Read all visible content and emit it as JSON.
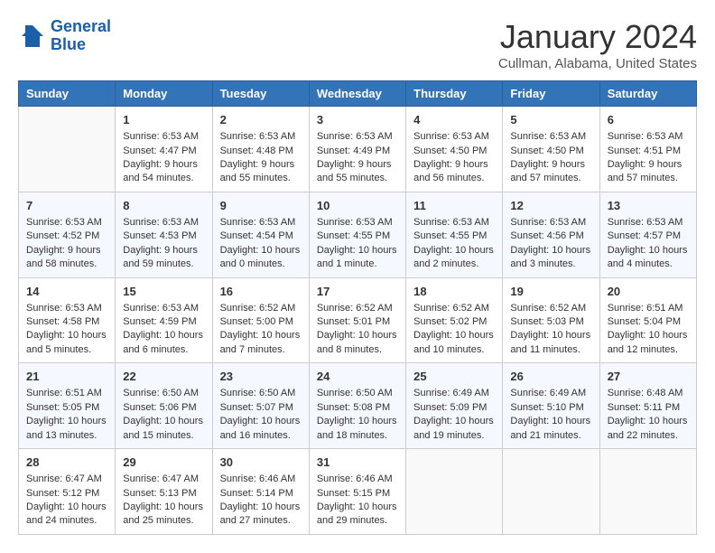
{
  "header": {
    "logo_line1": "General",
    "logo_line2": "Blue",
    "month": "January 2024",
    "location": "Cullman, Alabama, United States"
  },
  "days_of_week": [
    "Sunday",
    "Monday",
    "Tuesday",
    "Wednesday",
    "Thursday",
    "Friday",
    "Saturday"
  ],
  "weeks": [
    [
      {
        "day": "",
        "content": ""
      },
      {
        "day": "1",
        "content": "Sunrise: 6:53 AM\nSunset: 4:47 PM\nDaylight: 9 hours\nand 54 minutes."
      },
      {
        "day": "2",
        "content": "Sunrise: 6:53 AM\nSunset: 4:48 PM\nDaylight: 9 hours\nand 55 minutes."
      },
      {
        "day": "3",
        "content": "Sunrise: 6:53 AM\nSunset: 4:49 PM\nDaylight: 9 hours\nand 55 minutes."
      },
      {
        "day": "4",
        "content": "Sunrise: 6:53 AM\nSunset: 4:50 PM\nDaylight: 9 hours\nand 56 minutes."
      },
      {
        "day": "5",
        "content": "Sunrise: 6:53 AM\nSunset: 4:50 PM\nDaylight: 9 hours\nand 57 minutes."
      },
      {
        "day": "6",
        "content": "Sunrise: 6:53 AM\nSunset: 4:51 PM\nDaylight: 9 hours\nand 57 minutes."
      }
    ],
    [
      {
        "day": "7",
        "content": "Sunrise: 6:53 AM\nSunset: 4:52 PM\nDaylight: 9 hours\nand 58 minutes."
      },
      {
        "day": "8",
        "content": "Sunrise: 6:53 AM\nSunset: 4:53 PM\nDaylight: 9 hours\nand 59 minutes."
      },
      {
        "day": "9",
        "content": "Sunrise: 6:53 AM\nSunset: 4:54 PM\nDaylight: 10 hours\nand 0 minutes."
      },
      {
        "day": "10",
        "content": "Sunrise: 6:53 AM\nSunset: 4:55 PM\nDaylight: 10 hours\nand 1 minute."
      },
      {
        "day": "11",
        "content": "Sunrise: 6:53 AM\nSunset: 4:55 PM\nDaylight: 10 hours\nand 2 minutes."
      },
      {
        "day": "12",
        "content": "Sunrise: 6:53 AM\nSunset: 4:56 PM\nDaylight: 10 hours\nand 3 minutes."
      },
      {
        "day": "13",
        "content": "Sunrise: 6:53 AM\nSunset: 4:57 PM\nDaylight: 10 hours\nand 4 minutes."
      }
    ],
    [
      {
        "day": "14",
        "content": "Sunrise: 6:53 AM\nSunset: 4:58 PM\nDaylight: 10 hours\nand 5 minutes."
      },
      {
        "day": "15",
        "content": "Sunrise: 6:53 AM\nSunset: 4:59 PM\nDaylight: 10 hours\nand 6 minutes."
      },
      {
        "day": "16",
        "content": "Sunrise: 6:52 AM\nSunset: 5:00 PM\nDaylight: 10 hours\nand 7 minutes."
      },
      {
        "day": "17",
        "content": "Sunrise: 6:52 AM\nSunset: 5:01 PM\nDaylight: 10 hours\nand 8 minutes."
      },
      {
        "day": "18",
        "content": "Sunrise: 6:52 AM\nSunset: 5:02 PM\nDaylight: 10 hours\nand 10 minutes."
      },
      {
        "day": "19",
        "content": "Sunrise: 6:52 AM\nSunset: 5:03 PM\nDaylight: 10 hours\nand 11 minutes."
      },
      {
        "day": "20",
        "content": "Sunrise: 6:51 AM\nSunset: 5:04 PM\nDaylight: 10 hours\nand 12 minutes."
      }
    ],
    [
      {
        "day": "21",
        "content": "Sunrise: 6:51 AM\nSunset: 5:05 PM\nDaylight: 10 hours\nand 13 minutes."
      },
      {
        "day": "22",
        "content": "Sunrise: 6:50 AM\nSunset: 5:06 PM\nDaylight: 10 hours\nand 15 minutes."
      },
      {
        "day": "23",
        "content": "Sunrise: 6:50 AM\nSunset: 5:07 PM\nDaylight: 10 hours\nand 16 minutes."
      },
      {
        "day": "24",
        "content": "Sunrise: 6:50 AM\nSunset: 5:08 PM\nDaylight: 10 hours\nand 18 minutes."
      },
      {
        "day": "25",
        "content": "Sunrise: 6:49 AM\nSunset: 5:09 PM\nDaylight: 10 hours\nand 19 minutes."
      },
      {
        "day": "26",
        "content": "Sunrise: 6:49 AM\nSunset: 5:10 PM\nDaylight: 10 hours\nand 21 minutes."
      },
      {
        "day": "27",
        "content": "Sunrise: 6:48 AM\nSunset: 5:11 PM\nDaylight: 10 hours\nand 22 minutes."
      }
    ],
    [
      {
        "day": "28",
        "content": "Sunrise: 6:47 AM\nSunset: 5:12 PM\nDaylight: 10 hours\nand 24 minutes."
      },
      {
        "day": "29",
        "content": "Sunrise: 6:47 AM\nSunset: 5:13 PM\nDaylight: 10 hours\nand 25 minutes."
      },
      {
        "day": "30",
        "content": "Sunrise: 6:46 AM\nSunset: 5:14 PM\nDaylight: 10 hours\nand 27 minutes."
      },
      {
        "day": "31",
        "content": "Sunrise: 6:46 AM\nSunset: 5:15 PM\nDaylight: 10 hours\nand 29 minutes."
      },
      {
        "day": "",
        "content": ""
      },
      {
        "day": "",
        "content": ""
      },
      {
        "day": "",
        "content": ""
      }
    ]
  ]
}
